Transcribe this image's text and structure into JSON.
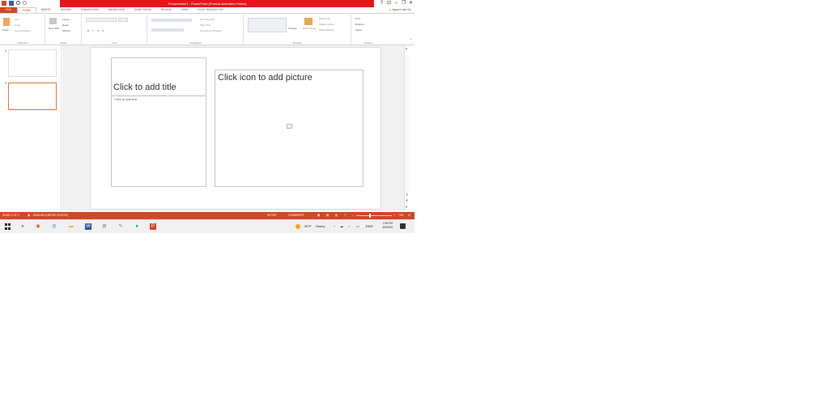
{
  "window": {
    "title": "Presentation1 - PowerPoint (Product Activation Failed)",
    "buttons": [
      "?",
      "⊡",
      "–",
      "❐",
      "✕"
    ]
  },
  "tabs": [
    {
      "label": "FILE"
    },
    {
      "label": "HOME"
    },
    {
      "label": "INSERT"
    },
    {
      "label": "DESIGN"
    },
    {
      "label": "TRANSITIONS"
    },
    {
      "label": "ANIMATIONS"
    },
    {
      "label": "SLIDE SHOW"
    },
    {
      "label": "REVIEW"
    },
    {
      "label": "VIEW"
    },
    {
      "label": "FOXIT READER PDF"
    }
  ],
  "user": "Nguyen Van Chi",
  "ribbon": {
    "clipboard": {
      "paste": "Paste",
      "cut": "Cut",
      "copy": "Copy",
      "format_painter": "Format Painter",
      "label": "Clipboard"
    },
    "slides": {
      "new_slide": "New Slide",
      "layout": "Layout",
      "reset": "Reset",
      "section": "Section",
      "label": "Slides"
    },
    "font": {
      "label": "Font",
      "bold": "B",
      "italic": "I",
      "underline": "U",
      "shadow": "S"
    },
    "paragraph": {
      "label": "Paragraph",
      "text_direction": "Text Direction",
      "align_text": "Align Text",
      "convert_smartart": "Convert to SmartArt"
    },
    "drawing": {
      "label": "Drawing",
      "arrange": "Arrange",
      "quick_styles": "Quick Styles",
      "shape_fill": "Shape Fill",
      "shape_outline": "Shape Outline",
      "shape_effects": "Shape Effects"
    },
    "editing": {
      "label": "Editing",
      "find": "Find",
      "replace": "Replace",
      "select": "Select"
    }
  },
  "thumbnails": [
    {
      "number": "1",
      "selected": false
    },
    {
      "number": "2",
      "selected": true
    }
  ],
  "slide": {
    "title_placeholder": "Click to add title",
    "text_placeholder": "Click to add text",
    "picture_placeholder": "Click icon to add picture"
  },
  "statusbar": {
    "slide_info": "SLIDE 2 OF 2",
    "language": "ENGLISH (UNITED STATES)",
    "notes": "NOTES",
    "comments": "COMMENTS",
    "zoom": "73%"
  },
  "taskbar": {
    "weather_temp": "30°F",
    "weather_desc": "Sunny",
    "language": "ENG",
    "time": "2:59 PM",
    "date": "6/5/2021"
  },
  "colors": {
    "accent": "#d24726",
    "title_red": "#e8141b",
    "selected_thumb": "#e8762b"
  }
}
